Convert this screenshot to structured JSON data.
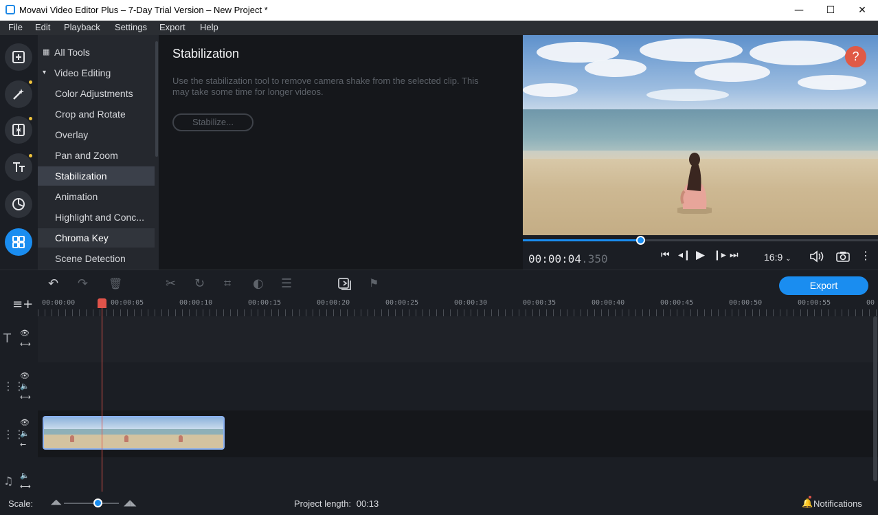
{
  "window": {
    "title": "Movavi Video Editor Plus – 7-Day Trial Version – New Project *",
    "minimize": "—",
    "maximize": "☐",
    "close": "✕"
  },
  "menu": [
    {
      "label": "File"
    },
    {
      "label": "Edit"
    },
    {
      "label": "Playback"
    },
    {
      "label": "Settings"
    },
    {
      "label": "Export"
    },
    {
      "label": "Help"
    }
  ],
  "rail": {
    "items": [
      {
        "name": "import-icon",
        "has_dot": false
      },
      {
        "name": "filters-icon",
        "has_dot": true
      },
      {
        "name": "transitions-icon",
        "has_dot": true
      },
      {
        "name": "titles-icon",
        "has_dot": true
      },
      {
        "name": "stickers-icon",
        "has_dot": false
      },
      {
        "name": "more-tools-icon",
        "has_dot": false,
        "active": true
      }
    ]
  },
  "tools": {
    "all_tools": "All Tools",
    "group": "Video Editing",
    "items": [
      "Color Adjustments",
      "Crop and Rotate",
      "Overlay",
      "Pan and Zoom",
      "Stabilization",
      "Animation",
      "Highlight and Conc...",
      "Chroma Key",
      "Scene Detection"
    ],
    "selected": "Stabilization"
  },
  "panel": {
    "heading": "Stabilization",
    "description": "Use the stabilization tool to remove camera shake from the selected clip. This may take some time for longer videos.",
    "button": "Stabilize..."
  },
  "preview": {
    "help": "?"
  },
  "player": {
    "time_main": "00:00:04",
    "time_ms": ".350",
    "progress": 0.33,
    "aspect_ratio": "16:9"
  },
  "toolbar": {
    "export_label": "Export"
  },
  "ruler": {
    "labels": [
      "00:00:00",
      "00:00:05",
      "00:00:10",
      "00:00:15",
      "00:00:20",
      "00:00:25",
      "00:00:30",
      "00:00:35",
      "00:00:40",
      "00:00:45",
      "00:00:50",
      "00:00:55",
      "00"
    ]
  },
  "status": {
    "scale_label": "Scale:",
    "project_length_label": "Project length:",
    "project_length_value": "00:13",
    "notifications": "Notifications"
  },
  "colors": {
    "accent": "#1a8df0",
    "playhead": "#e0534a",
    "background": "#1b1e24"
  }
}
